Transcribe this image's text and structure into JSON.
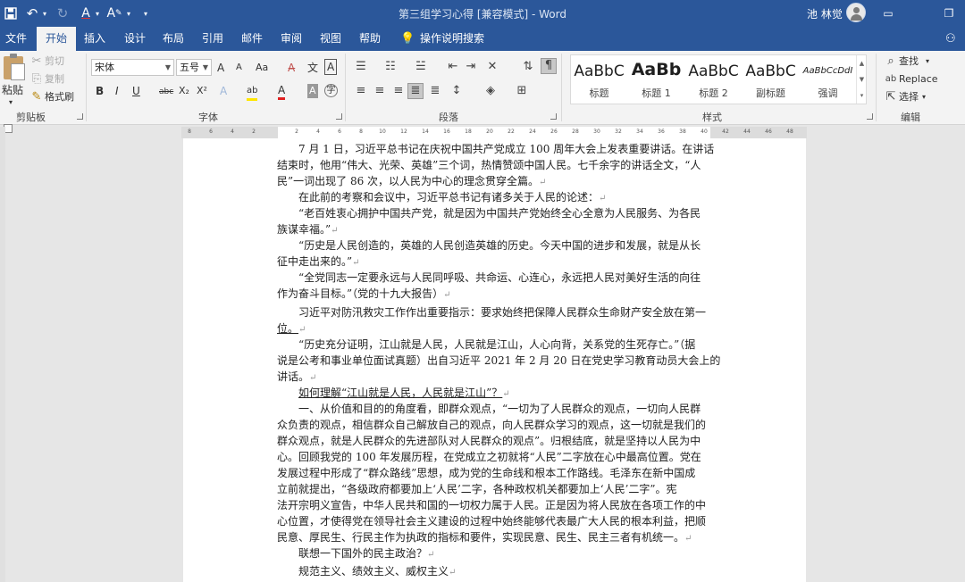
{
  "app": {
    "title": "第三组学习心得 [兼容模式] - Word",
    "user": "池 林觉",
    "icons": [
      "save-icon",
      "undo-icon",
      "redo-icon",
      "font-color-icon",
      "text-highlight-icon",
      "customize-qat-icon",
      "avatar-icon",
      "ribbon-display-icon",
      "restore-window-icon",
      "share-icon"
    ]
  },
  "tabs": [
    {
      "label": "文件",
      "active": false
    },
    {
      "label": "开始",
      "active": true
    },
    {
      "label": "插入",
      "active": false
    },
    {
      "label": "设计",
      "active": false
    },
    {
      "label": "布局",
      "active": false
    },
    {
      "label": "引用",
      "active": false
    },
    {
      "label": "邮件",
      "active": false
    },
    {
      "label": "审阅",
      "active": false
    },
    {
      "label": "视图",
      "active": false
    },
    {
      "label": "帮助",
      "active": false
    }
  ],
  "tell_me": "操作说明搜索",
  "clipboard": {
    "paste": "粘贴",
    "cut": "剪切",
    "copy": "复制",
    "format_painter": "格式刷",
    "group_label": "剪贴板"
  },
  "font": {
    "name": "宋体",
    "size": "五号",
    "grow": "A",
    "shrink": "A",
    "change_case": "Aa",
    "group_label": "字体",
    "bold": "B",
    "italic": "I",
    "underline": "U",
    "strike": "abc",
    "subscript": "X₂",
    "superscript": "X²",
    "text_effects": "A",
    "highlight": "ab",
    "font_color": "A",
    "char_shading": "A",
    "enclose": "字",
    "phonetic": "文",
    "char_border": "A"
  },
  "paragraph": {
    "group_label": "段落"
  },
  "styles": {
    "group_label": "样式",
    "items": [
      {
        "sample": "AaBbC",
        "name": "标题"
      },
      {
        "sample": "AaBb",
        "name": "标题 1"
      },
      {
        "sample": "AaBbC",
        "name": "标题 2"
      },
      {
        "sample": "AaBbC",
        "name": "副标题"
      },
      {
        "sample": "AaBbCcDdI",
        "name": "强调"
      }
    ]
  },
  "editing": {
    "find": "查找",
    "replace": "Replace",
    "select": "选择",
    "group_label": "编辑"
  },
  "ruler": {
    "labels": [
      "8",
      "6",
      "4",
      "2",
      "",
      "2",
      "4",
      "6",
      "8",
      "10",
      "12",
      "14",
      "16",
      "18",
      "20",
      "22",
      "24",
      "26",
      "28",
      "30",
      "32",
      "34",
      "36",
      "38",
      "40",
      "42",
      "44",
      "46",
      "48"
    ]
  },
  "doc": {
    "lines": [
      "7 月 1 日，习近平总书记在庆祝中国共产党成立 100 周年大会上发表重要讲话。在讲话",
      "结束时，他用“伟大、光荣、英雄”三个词，热情赞颂中国人民。七千余字的讲话全文，“人",
      "民”一词出现了 86 次，以人民为中心的理念贯穿全篇。",
      "在此前的考察和会议中，习近平总书记有诸多关于人民的论述：",
      "“老百姓衷心拥护中国共产党，就是因为中国共产党始终全心全意为人民服务、为各民",
      "族谋幸福。”",
      "“历史是人民创造的，英雄的人民创造英雄的历史。今天中国的进步和发展，就是从长",
      "征中走出来的。”",
      "“全党同志一定要永远与人民同呼吸、共命运、心连心，永远把人民对美好生活的向往",
      "作为奋斗目标。”（党的十九大报告）",
      "习近平对防汛救灾工作作出重要指示：要求始终把保障人民群众生命财产安全放在第一",
      "位。",
      "“历史充分证明，江山就是人民，人民就是江山，人心向背，关系党的生死存亡。”（据",
      "说是公考和事业单位面试真题）出自习近平 2021 年 2 月 20 日在党史学习教育动员大会上的",
      "讲话。",
      "如何理解“江山就是人民，人民就是江山”？",
      "一、从价值和目的的角度看，即群众观点，“一切为了人民群众的观点，一切向人民群",
      "众负责的观点，相信群众自己解放自己的观点，向人民群众学习的观点，这一切就是我们的",
      "群众观点，就是人民群众的先进部队对人民群众的观点”。归根结底，就是坚持以人民为中",
      "心。回顾我党的 100 年发展历程，在党成立之初就将“人民”二字放在心中最高位置。党在",
      "发展过程中形成了“群众路线”思想，成为党的生命线和根本工作路线。毛泽东在新中国成",
      "立前就提出，“各级政府都要加上‘人民’二字，各种政权机关都要加上‘人民’二字”。宪",
      "法开宗明义宣告，中华人民共和国的一切权力属于人民。正是因为将人民放在各项工作的中",
      "心位置，才使得党在领导社会主义建设的过程中始终能够代表最广大人民的根本利益，把顺",
      "民意、厚民生、行民主作为执政的指标和要件，实现民意、民生、民主三者有机统一。",
      "联想一下国外的民主政治？",
      "规范主义、绩效主义、威权主义"
    ],
    "paragraph_mark": "↵"
  }
}
